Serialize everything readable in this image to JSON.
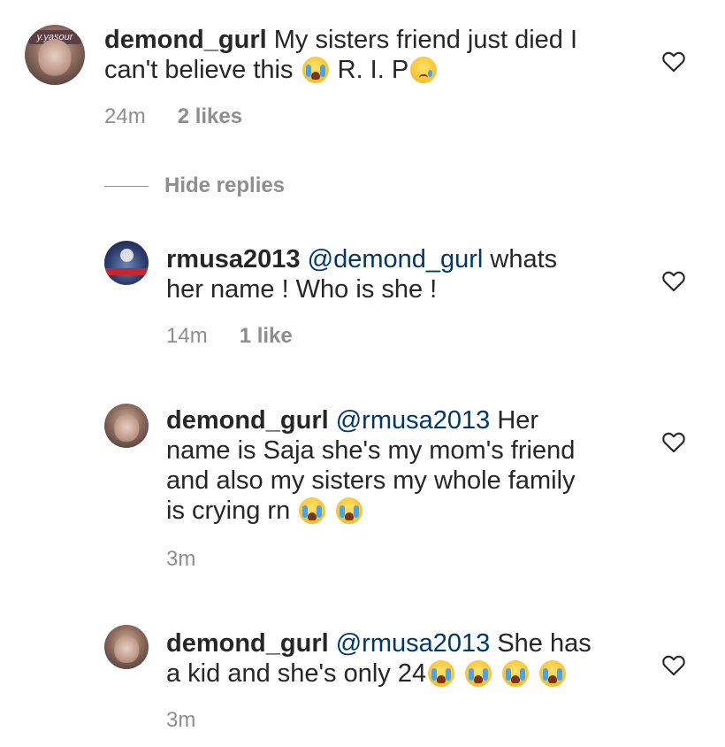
{
  "comments": [
    {
      "username": "demond_gurl",
      "mention": "",
      "line1": "My sisters friend just died I",
      "line2": "can't believe this",
      "line2_tail": "R. I. P",
      "time": "24m",
      "likes": "2 likes",
      "avatar_tag": "y.yasour"
    },
    {
      "username": "rmusa2013",
      "mention": "@demond_gurl",
      "line1": "whats",
      "line2": "her name ! Who is she !",
      "time": "14m",
      "likes": "1 like"
    },
    {
      "username": "demond_gurl",
      "mention": "@rmusa2013",
      "line1": "Her",
      "line2": "name is Saja she's my mom's friend",
      "line3": "and also my sisters my whole family",
      "line4": "is crying rn",
      "time": "3m",
      "likes": ""
    },
    {
      "username": "demond_gurl",
      "mention": "@rmusa2013",
      "line1": "She has",
      "line2": "a kid and she's only 24",
      "time": "3m",
      "likes": ""
    }
  ],
  "hide_replies_label": "Hide replies",
  "icons": {
    "like": "heart-icon",
    "crying": "loudly-crying-face-emoji",
    "sad": "crying-face-emoji"
  },
  "colors": {
    "text": "#262626",
    "meta": "#8e8e8e",
    "mention": "#00376b"
  }
}
